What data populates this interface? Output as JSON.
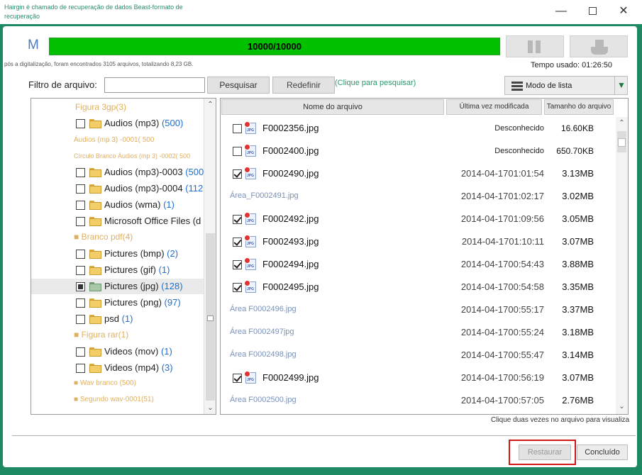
{
  "window": {
    "title": "Hairgin é chamado de recuperação de dados Beast-formato de recuperação",
    "min_glyph": "—",
    "close_glyph": "✕"
  },
  "scan": {
    "logo_text": "M",
    "progress_text": "10000/10000",
    "progress_fraction": 1.0,
    "summary": "pós a digitalização, foram encontrados 3105 arquivos, totalizando 8,23 GB.",
    "time_used": "Tempo usado: 01:26:50"
  },
  "filter": {
    "label": "Filtro de arquivo:",
    "value": "",
    "search_label": "Pesquisar",
    "reset_label": "Redefinir",
    "hint": "(Clique para pesquisar)",
    "view_mode_label": "Modo de lista",
    "view_mode_arrow": "▼"
  },
  "tree": {
    "ghost_1": "Figura 3gp(3)",
    "ghost_2": "Áudios (mp 3) -0001( 500",
    "ghost_3": "Círculo Branco Áudios (mp 3) -0002( 500",
    "ghost_4": "■ Branco pdf(4)",
    "ghost_5": "■ Figura rar(1)",
    "ghost_6": "■ Wav branco (500)",
    "ghost_7": "■ Segundo wav-0001(51)",
    "items": [
      {
        "name": "Audios (mp3)",
        "count": "(500)"
      },
      {
        "name": "Audios (mp3)-0003",
        "count": "(500"
      },
      {
        "name": "Audios (mp3)-0004",
        "count": "(112"
      },
      {
        "name": "Audios (wma)",
        "count": "(1)"
      },
      {
        "name": "Microsoft Office Files (d",
        "count": ""
      },
      {
        "name": "Pictures (bmp)",
        "count": "(2)"
      },
      {
        "name": "Pictures (gif)",
        "count": "(1)"
      },
      {
        "name": "Pictures (jpg)",
        "count": "(128)"
      },
      {
        "name": "Pictures (png)",
        "count": "(97)"
      },
      {
        "name": "psd",
        "count": "(1)"
      },
      {
        "name": "Videos (mov)",
        "count": "(1)"
      },
      {
        "name": "Videos (mp4)",
        "count": "(3)"
      }
    ]
  },
  "list": {
    "headers": {
      "name": "Nome do arquivo",
      "date": "Última vez modificada",
      "size": "Tamanho do arquivo"
    },
    "icon_label": "JPG",
    "rows": [
      {
        "name": "F0002356.jpg",
        "date": "Desconhecido",
        "size": "16.60KB",
        "checked": false
      },
      {
        "name": "F0002400.jpg",
        "date": "Desconhecido",
        "size": "650.70KB",
        "checked": false
      },
      {
        "name": "F0002490.jpg",
        "date": "2014-04-1701:01:54",
        "size": "3.13MB",
        "checked": true
      },
      {
        "name": "Área_F0002491.jpg",
        "date": "2014-04-1701:02:17",
        "size": "3.02MB",
        "ghost": true
      },
      {
        "name": "F0002492.jpg",
        "date": "2014-04-1701:09:56",
        "size": "3.05MB",
        "checked": true
      },
      {
        "name": "F0002493.jpg",
        "date": "2014-04-1701:10:11",
        "size": "3.07MB",
        "checked": true
      },
      {
        "name": "F0002494.jpg",
        "date": "2014-04-1700:54:43",
        "size": "3.88MB",
        "checked": true
      },
      {
        "name": "F0002495.jpg",
        "date": "2014-04-1700:54:58",
        "size": "3.35MB",
        "checked": true
      },
      {
        "name": "Área F0002496.jpg",
        "date": "2014-04-1700:55:17",
        "size": "3.37MB",
        "ghost": true
      },
      {
        "name": "Área F0002497jpg",
        "date": "2014-04-1700:55:24",
        "size": "3.18MB",
        "ghost": true
      },
      {
        "name": "Área F0002498.jpg",
        "date": "2014-04-1700:55:47",
        "size": "3.14MB",
        "ghost": true
      },
      {
        "name": "F0002499.jpg",
        "date": "2014-04-1700:56:19",
        "size": "3.07MB",
        "checked": true
      },
      {
        "name": "Área F0002500.jpg",
        "date": "2014-04-1700:57:05",
        "size": "2.76MB",
        "ghost": true
      }
    ]
  },
  "footer": {
    "double_click_hint": "Clique duas vezes no arquivo para visualiza",
    "restore_label": "Restaurar",
    "done_label": "Concluído"
  },
  "colors": {
    "background": "#1e8a63",
    "progress": "#00c000",
    "accent_green": "#2a9a6a",
    "highlight_red": "#d01818"
  }
}
